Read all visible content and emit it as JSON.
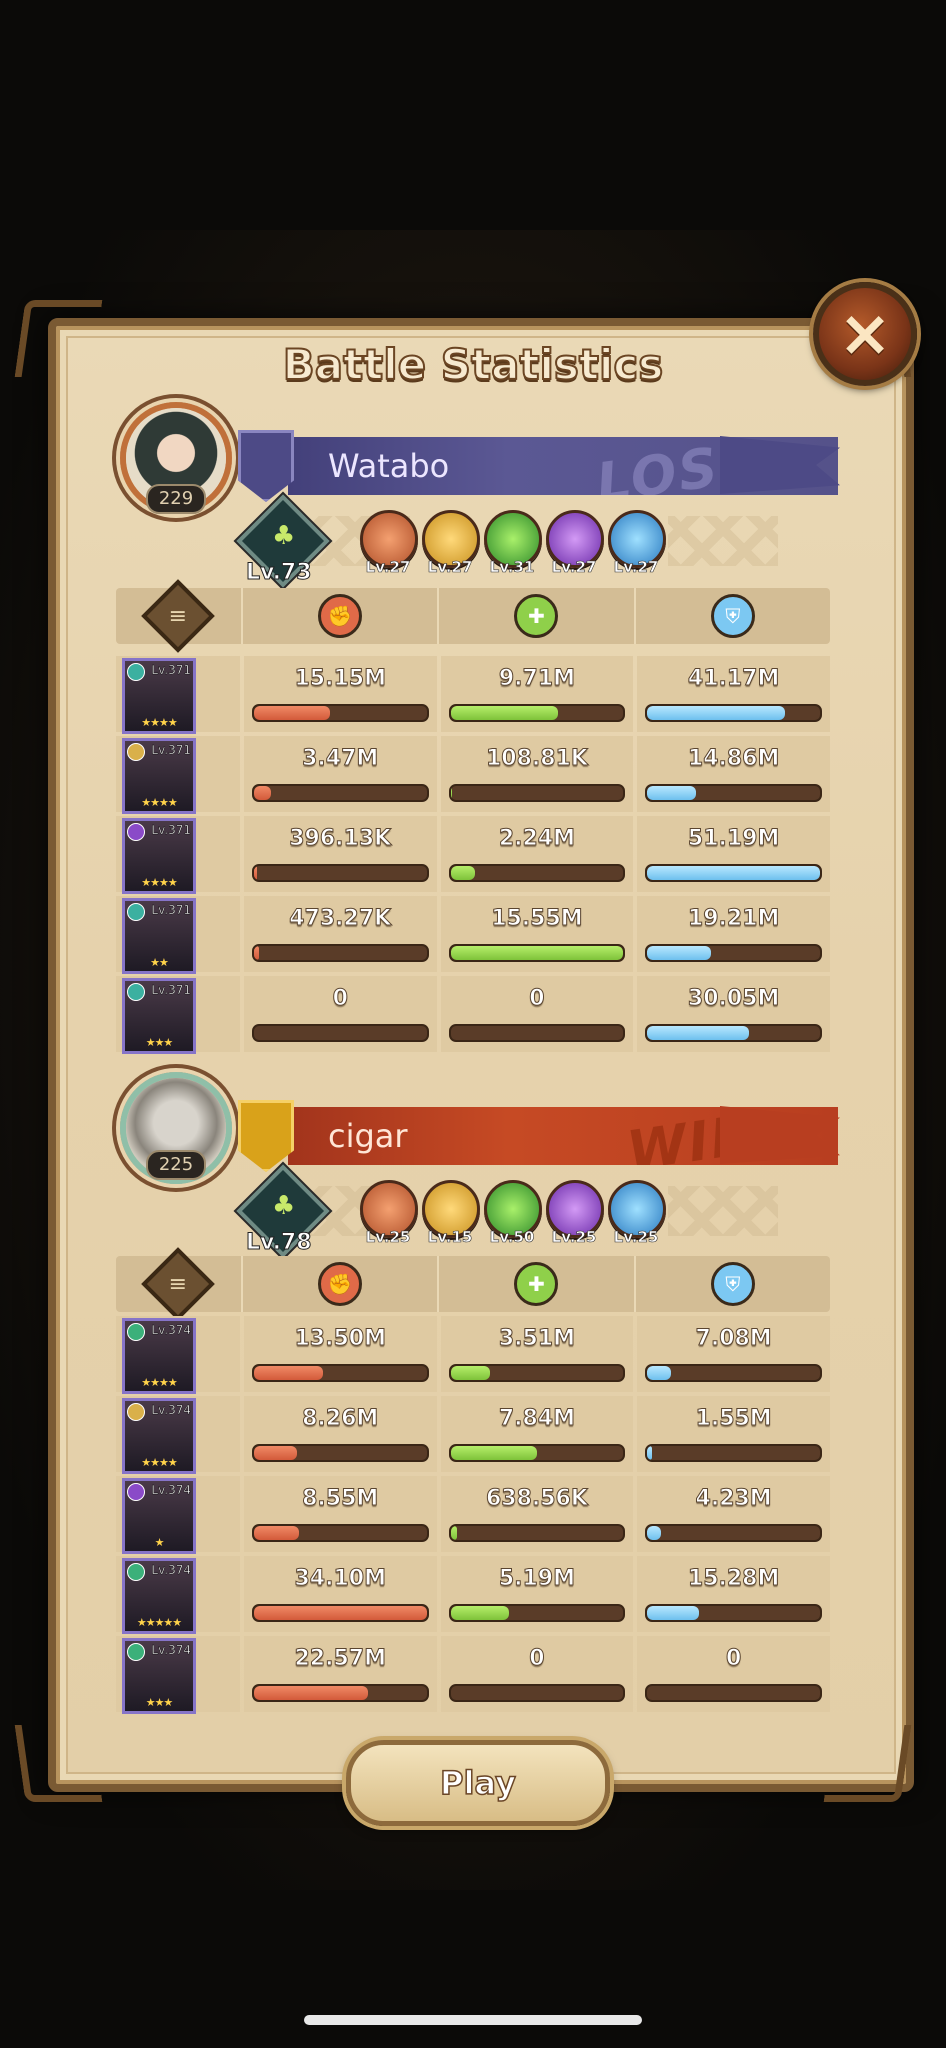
{
  "title": "Battle Statistics",
  "close_icon": "×",
  "play_label": "Play",
  "colors": {
    "damage": "#e06a48",
    "healing": "#8fd04a",
    "tank": "#7cc8f2",
    "lose_banner": "#55528a",
    "win_banner": "#c04224"
  },
  "teams": [
    {
      "player_name": "Watabo",
      "player_level": "229",
      "result": "LOSE",
      "resonance_level": "Lv.73",
      "faction_levels": [
        "Lv.27",
        "Lv.27",
        "Lv.31",
        "Lv.27",
        "Lv.27"
      ],
      "heroes": [
        {
          "level": "Lv.371",
          "stars": "★★★★",
          "damage": "15.15M",
          "damage_pct": 0.44,
          "healing": "9.71M",
          "healing_pct": 0.62,
          "tank": "41.17M",
          "tank_pct": 0.8
        },
        {
          "level": "Lv.371",
          "stars": "★★★★",
          "damage": "3.47M",
          "damage_pct": 0.1,
          "healing": "108.81K",
          "healing_pct": 0.01,
          "tank": "14.86M",
          "tank_pct": 0.28
        },
        {
          "level": "Lv.371",
          "stars": "★★★★",
          "damage": "396.13K",
          "damage_pct": 0.02,
          "healing": "2.24M",
          "healing_pct": 0.14,
          "tank": "51.19M",
          "tank_pct": 1.0
        },
        {
          "level": "Lv.371",
          "stars": "★★",
          "damage": "473.27K",
          "damage_pct": 0.03,
          "healing": "15.55M",
          "healing_pct": 1.0,
          "tank": "19.21M",
          "tank_pct": 0.37
        },
        {
          "level": "Lv.371",
          "stars": "★★★",
          "damage": "0",
          "damage_pct": 0,
          "healing": "0",
          "healing_pct": 0,
          "tank": "30.05M",
          "tank_pct": 0.59
        }
      ]
    },
    {
      "player_name": "cigar",
      "player_level": "225",
      "result": "WIN",
      "resonance_level": "Lv.78",
      "faction_levels": [
        "Lv.25",
        "Lv.15",
        "Lv.50",
        "Lv.25",
        "Lv.25"
      ],
      "heroes": [
        {
          "level": "Lv.374",
          "stars": "★★★★",
          "damage": "13.50M",
          "damage_pct": 0.4,
          "healing": "3.51M",
          "healing_pct": 0.23,
          "tank": "7.08M",
          "tank_pct": 0.14
        },
        {
          "level": "Lv.374",
          "stars": "★★★★",
          "damage": "8.26M",
          "damage_pct": 0.25,
          "healing": "7.84M",
          "healing_pct": 0.5,
          "tank": "1.55M",
          "tank_pct": 0.03
        },
        {
          "level": "Lv.374",
          "stars": "★",
          "damage": "8.55M",
          "damage_pct": 0.26,
          "healing": "638.56K",
          "healing_pct": 0.04,
          "tank": "4.23M",
          "tank_pct": 0.08
        },
        {
          "level": "Lv.374",
          "stars": "★★★★★",
          "damage": "34.10M",
          "damage_pct": 1.0,
          "healing": "5.19M",
          "healing_pct": 0.34,
          "tank": "15.28M",
          "tank_pct": 0.3
        },
        {
          "level": "Lv.374",
          "stars": "★★★",
          "damage": "22.57M",
          "damage_pct": 0.66,
          "healing": "0",
          "healing_pct": 0,
          "tank": "0",
          "tank_pct": 0
        }
      ]
    }
  ]
}
